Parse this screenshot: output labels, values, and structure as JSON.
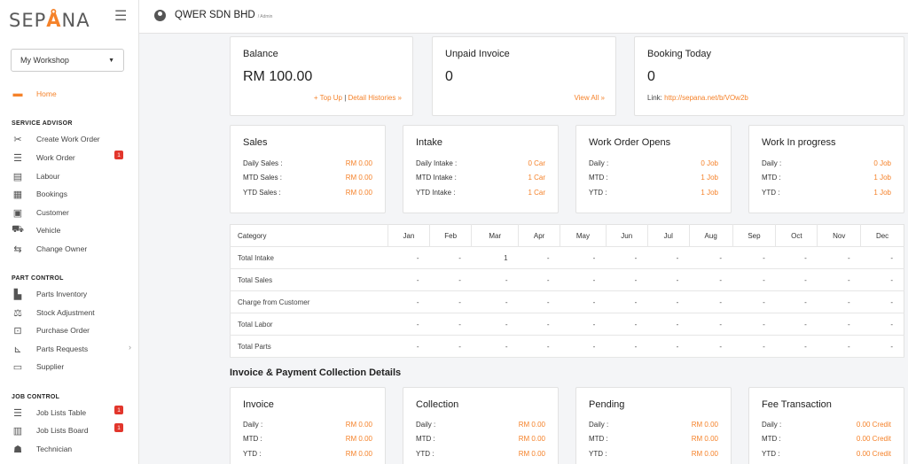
{
  "brand": {
    "logo_left": "SEP",
    "logo_mid": "Å",
    "logo_right": "NA"
  },
  "sidebar": {
    "workshop_select": "My Workshop",
    "home": "Home",
    "service_advisor_title": "SERVICE ADVISOR",
    "service_advisor": [
      {
        "label": "Create Work Order",
        "icon": "tools-icon"
      },
      {
        "label": "Work Order",
        "icon": "list-icon",
        "badge": "1"
      },
      {
        "label": "Labour",
        "icon": "clipboard-icon"
      },
      {
        "label": "Bookings",
        "icon": "calendar-icon"
      },
      {
        "label": "Customer",
        "icon": "id-card-icon"
      },
      {
        "label": "Vehicle",
        "icon": "car-icon"
      },
      {
        "label": "Change Owner",
        "icon": "exchange-icon"
      }
    ],
    "part_control_title": "PART CONTROL",
    "part_control": [
      {
        "label": "Parts Inventory",
        "icon": "boxes-icon"
      },
      {
        "label": "Stock Adjustment",
        "icon": "balance-icon"
      },
      {
        "label": "Purchase Order",
        "icon": "cart-icon"
      },
      {
        "label": "Parts Requests",
        "icon": "dolly-icon"
      },
      {
        "label": "Supplier",
        "icon": "store-icon"
      }
    ],
    "job_control_title": "JOB CONTROL",
    "job_control": [
      {
        "label": "Job Lists Table",
        "icon": "list-icon",
        "badge": "1"
      },
      {
        "label": "Job Lists Board",
        "icon": "board-icon",
        "badge": "1"
      },
      {
        "label": "Technician",
        "icon": "users-icon"
      }
    ]
  },
  "topbar": {
    "company": "QWER SDN BHD",
    "role": "/ Admin"
  },
  "summary": {
    "balance": {
      "title": "Balance",
      "value": "RM 100.00",
      "link1": "+ Top Up",
      "sep": " | ",
      "link2": "Detail Histories »"
    },
    "unpaid": {
      "title": "Unpaid Invoice",
      "value": "0",
      "link": "View All »"
    },
    "booking": {
      "title": "Booking Today",
      "value": "0",
      "link_label": "Link: ",
      "link_url": "http://sepana.net/b/VOw2b"
    }
  },
  "stats_cards": [
    {
      "title": "Sales",
      "rows": [
        {
          "label": "Daily Sales :",
          "value": "RM 0.00"
        },
        {
          "label": "MTD Sales :",
          "value": "RM 0.00"
        },
        {
          "label": "YTD Sales :",
          "value": "RM 0.00"
        }
      ]
    },
    {
      "title": "Intake",
      "rows": [
        {
          "label": "Daily Intake :",
          "value": "0 Car"
        },
        {
          "label": "MTD Intake :",
          "value": "1 Car"
        },
        {
          "label": "YTD Intake :",
          "value": "1 Car"
        }
      ]
    },
    {
      "title": "Work Order Opens",
      "rows": [
        {
          "label": "Daily :",
          "value": "0 Job"
        },
        {
          "label": "MTD :",
          "value": "1 Job"
        },
        {
          "label": "YTD :",
          "value": "1 Job"
        }
      ]
    },
    {
      "title": "Work In progress",
      "rows": [
        {
          "label": "Daily :",
          "value": "0 Job"
        },
        {
          "label": "MTD :",
          "value": "1 Job"
        },
        {
          "label": "YTD :",
          "value": "1 Job"
        }
      ]
    }
  ],
  "monthly_table": {
    "header": [
      "Category",
      "Jan",
      "Feb",
      "Mar",
      "Apr",
      "May",
      "Jun",
      "Jul",
      "Aug",
      "Sep",
      "Oct",
      "Nov",
      "Dec"
    ],
    "rows": [
      [
        "Total Intake",
        "-",
        "-",
        "1",
        "-",
        "-",
        "-",
        "-",
        "-",
        "-",
        "-",
        "-",
        "-"
      ],
      [
        "Total Sales",
        "-",
        "-",
        "-",
        "-",
        "-",
        "-",
        "-",
        "-",
        "-",
        "-",
        "-",
        "-"
      ],
      [
        "Charge from Customer",
        "-",
        "-",
        "-",
        "-",
        "-",
        "-",
        "-",
        "-",
        "-",
        "-",
        "-",
        "-"
      ],
      [
        "Total Labor",
        "-",
        "-",
        "-",
        "-",
        "-",
        "-",
        "-",
        "-",
        "-",
        "-",
        "-",
        "-"
      ],
      [
        "Total Parts",
        "-",
        "-",
        "-",
        "-",
        "-",
        "-",
        "-",
        "-",
        "-",
        "-",
        "-",
        "-"
      ]
    ]
  },
  "invoice_section": {
    "heading": "Invoice & Payment Collection Details",
    "cards": [
      {
        "title": "Invoice",
        "rows": [
          {
            "label": "Daily :",
            "value": "RM 0.00"
          },
          {
            "label": "MTD :",
            "value": "RM 0.00"
          },
          {
            "label": "YTD :",
            "value": "RM 0.00"
          }
        ]
      },
      {
        "title": "Collection",
        "rows": [
          {
            "label": "Daily :",
            "value": "RM 0.00"
          },
          {
            "label": "MTD :",
            "value": "RM 0.00"
          },
          {
            "label": "YTD :",
            "value": "RM 0.00"
          }
        ]
      },
      {
        "title": "Pending",
        "rows": [
          {
            "label": "Daily :",
            "value": "RM 0.00"
          },
          {
            "label": "MTD :",
            "value": "RM 0.00"
          },
          {
            "label": "YTD :",
            "value": "RM 0.00"
          }
        ]
      },
      {
        "title": "Fee Transaction",
        "rows": [
          {
            "label": "Daily :",
            "value": "0.00 Credit"
          },
          {
            "label": "MTD :",
            "value": "0.00 Credit"
          },
          {
            "label": "YTD :",
            "value": "0.00 Credit"
          }
        ]
      }
    ]
  },
  "colors": {
    "accent": "#f5822a",
    "badge": "#e2362c"
  }
}
